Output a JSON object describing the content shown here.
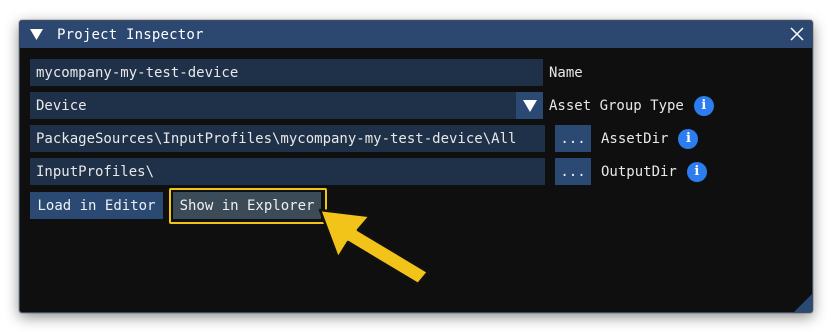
{
  "window": {
    "title": "Project Inspector"
  },
  "name_row": {
    "value": "mycompany-my-test-device",
    "label": "Name"
  },
  "asset_group_row": {
    "value": "Device",
    "label": "Asset Group Type"
  },
  "asset_dir_row": {
    "value": "PackageSources\\InputProfiles\\mycompany-my-test-device\\All",
    "browse_label": "...",
    "label": "AssetDir"
  },
  "output_dir_row": {
    "value": "InputProfiles\\",
    "browse_label": "...",
    "label": "OutputDir"
  },
  "actions": {
    "load_label": "Load in Editor",
    "show_label": "Show in Explorer"
  },
  "info_glyph": "i",
  "icons": {
    "collapse": "triangle-down-icon",
    "close": "close-icon",
    "dropdown": "triangle-down-icon",
    "info": "info-icon",
    "pointer": "arrow-annotation"
  },
  "colors": {
    "titlebar": "#2c4770",
    "field": "#1f3148",
    "button": "#2b4a73",
    "info": "#2c7df0",
    "highlight": "#f2c318"
  }
}
